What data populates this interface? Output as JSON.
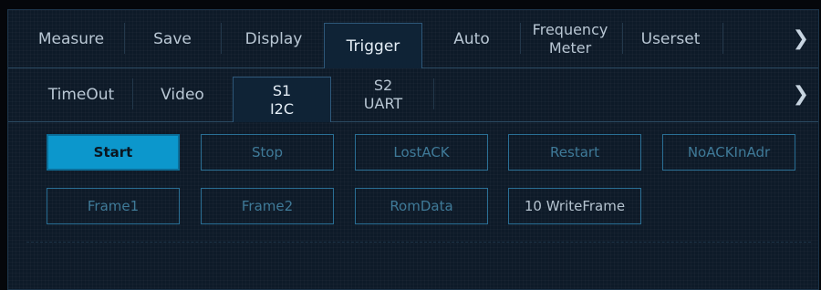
{
  "tabs_row1": {
    "items": [
      {
        "label": "Measure"
      },
      {
        "label": "Save"
      },
      {
        "label": "Display"
      },
      {
        "label": "Trigger",
        "active": true
      },
      {
        "label": "Auto"
      },
      {
        "label_line1": "Frequency",
        "label_line2": "Meter"
      },
      {
        "label": "Userset"
      }
    ],
    "next_glyph": "❯"
  },
  "tabs_row2": {
    "items": [
      {
        "label": "TimeOut"
      },
      {
        "label": "Video"
      },
      {
        "label_line1": "S1",
        "label_line2": "I2C",
        "active": true
      },
      {
        "label_line1": "S2",
        "label_line2": "UART"
      }
    ],
    "next_glyph": "❯"
  },
  "trigger_buttons": {
    "row1": [
      "Start",
      "Stop",
      "LostACK",
      "Restart",
      "NoACKInAdr"
    ],
    "row2": [
      "Frame1",
      "Frame2",
      "RomData",
      "10 WriteFrame"
    ],
    "selected": "Start"
  },
  "colors": {
    "accent": "#0c97cc",
    "panel_bg": "#0d1a28",
    "button_border": "#2a6f95"
  }
}
